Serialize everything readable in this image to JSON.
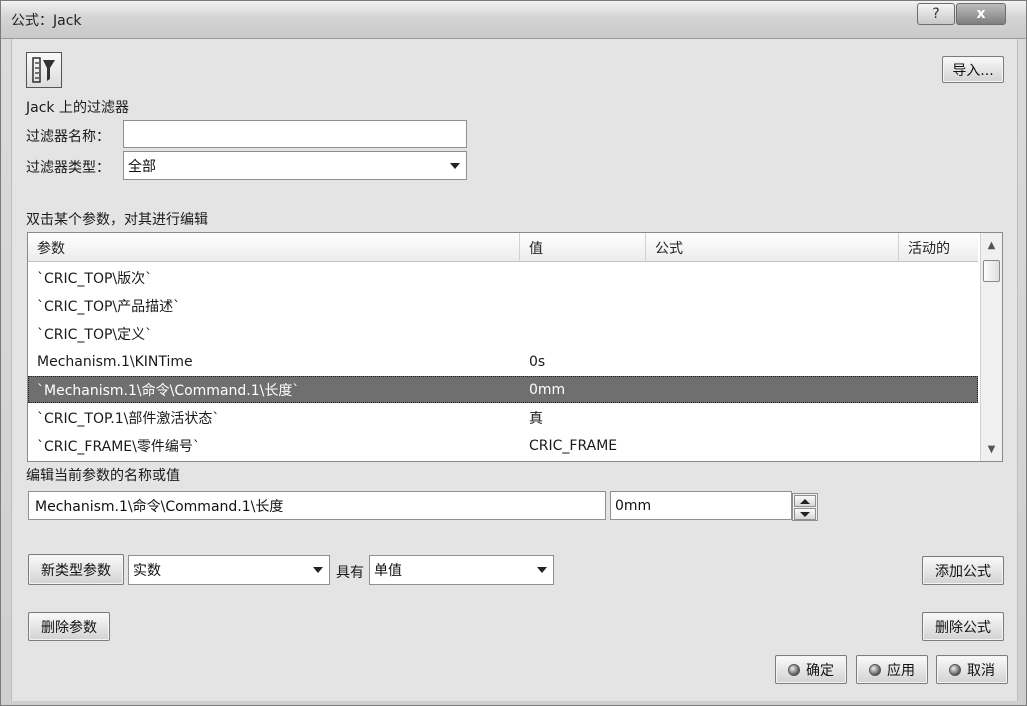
{
  "window": {
    "title": "公式：Jack",
    "help_label": "?",
    "close_label": "x"
  },
  "toolbar": {
    "import_label": "导入..."
  },
  "filter": {
    "heading": "Jack 上的过滤器",
    "name_label": "过滤器名称：",
    "name_value": "",
    "type_label": "过滤器类型：",
    "type_value": "全部"
  },
  "table": {
    "instruction": "双击某个参数，对其进行编辑",
    "columns": [
      "参数",
      "值",
      "公式",
      "活动的"
    ],
    "rows": [
      {
        "param": "`CRIC_TOP\\版次`",
        "value": "",
        "formula": "",
        "active": ""
      },
      {
        "param": "`CRIC_TOP\\产品描述`",
        "value": "",
        "formula": "",
        "active": ""
      },
      {
        "param": "`CRIC_TOP\\定义`",
        "value": "",
        "formula": "",
        "active": ""
      },
      {
        "param": "Mechanism.1\\KINTime",
        "value": "0s",
        "formula": "",
        "active": ""
      },
      {
        "param": "`Mechanism.1\\命令\\Command.1\\长度`",
        "value": "0mm",
        "formula": "",
        "active": ""
      },
      {
        "param": "`CRIC_TOP.1\\部件激活状态`",
        "value": "真",
        "formula": "",
        "active": ""
      },
      {
        "param": "`CRIC_FRAME\\零件编号`",
        "value": "CRIC_FRAME",
        "formula": "",
        "active": ""
      }
    ],
    "selected_index": 4
  },
  "edit": {
    "label": "编辑当前参数的名称或值",
    "name_value": "Mechanism.1\\命令\\Command.1\\长度",
    "value_value": "0mm"
  },
  "new_param": {
    "button_label": "新类型参数",
    "type_value": "实数",
    "with_label": "具有",
    "mode_value": "单值"
  },
  "actions": {
    "add_formula": "添加公式",
    "delete_param": "删除参数",
    "delete_formula": "删除公式",
    "ok": "确定",
    "apply": "应用",
    "cancel": "取消"
  }
}
